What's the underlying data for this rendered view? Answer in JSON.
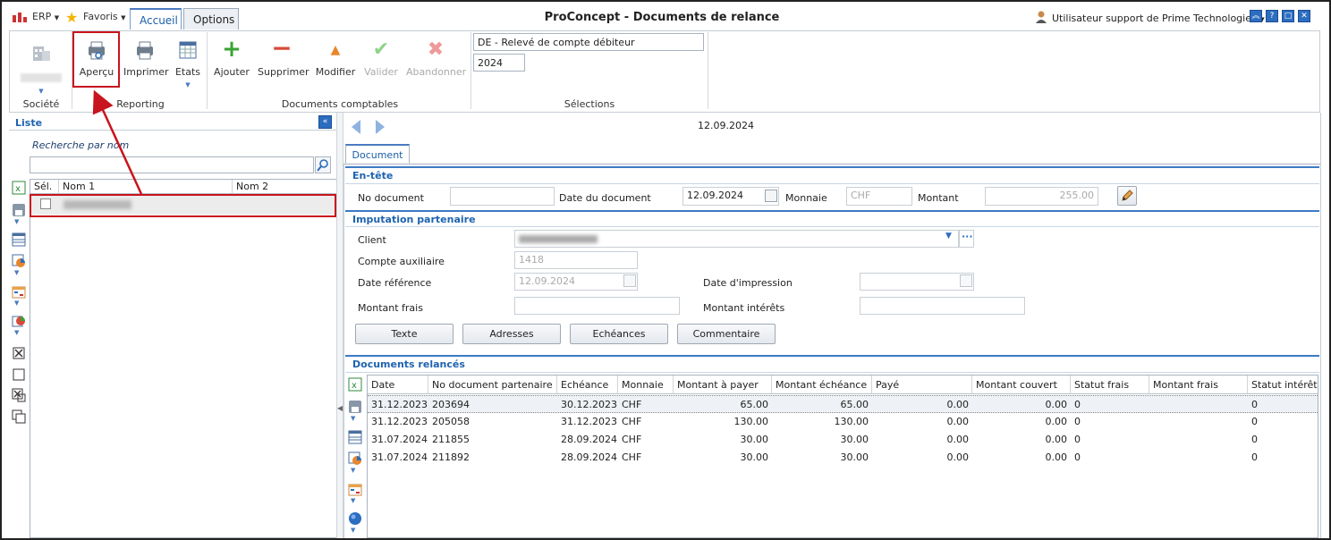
{
  "titlebar": {
    "erp_menu": "ERP",
    "favoris_menu": "Favoris",
    "tabs": [
      "Accueil",
      "Options"
    ],
    "app_title": "ProConcept - Documents de relance",
    "user": "Utilisateur support de Prime Technologies"
  },
  "ribbon": {
    "groups": {
      "societe": "Société",
      "reporting": "Reporting",
      "docs": "Documents comptables",
      "selections": "Sélections"
    },
    "buttons": {
      "apercu": "Aperçu",
      "imprimer": "Imprimer",
      "etats": "Etats",
      "ajouter": "Ajouter",
      "supprimer": "Supprimer",
      "modifier": "Modifier",
      "valider": "Valider",
      "abandonner": "Abandonner"
    },
    "selection_value": "DE - Relevé de compte débiteur",
    "year_value": "2024"
  },
  "liste": {
    "title": "Liste",
    "search_label": "Recherche par nom",
    "columns": [
      "Sél.",
      "Nom 1",
      "Nom 2"
    ]
  },
  "detail": {
    "current_date": "12.09.2024",
    "tab": "Document",
    "entete": {
      "title": "En-tête",
      "no_document_label": "No document",
      "no_document": "",
      "date_doc_label": "Date du document",
      "date_doc": "12.09.2024",
      "monnaie_label": "Monnaie",
      "monnaie": "CHF",
      "montant_label": "Montant",
      "montant": "255.00"
    },
    "imputation": {
      "title": "Imputation partenaire",
      "client_label": "Client",
      "compte_aux_label": "Compte auxiliaire",
      "compte_aux": "1418",
      "date_ref_label": "Date référence",
      "date_ref": "12.09.2024",
      "date_impr_label": "Date d'impression",
      "montant_frais_label": "Montant frais",
      "montant_interets_label": "Montant intérêts"
    },
    "actions": [
      "Texte",
      "Adresses",
      "Echéances",
      "Commentaire"
    ],
    "relances": {
      "title": "Documents relancés",
      "columns": [
        "Date",
        "No document partenaire",
        "Echéance",
        "Monnaie",
        "Montant à payer",
        "Montant échéance",
        "Payé",
        "Montant couvert",
        "Statut frais",
        "Montant frais",
        "Statut intérêts m"
      ],
      "rows": [
        [
          "31.12.2023",
          "203694",
          "30.12.2023",
          "CHF",
          "65.00",
          "65.00",
          "0.00",
          "0.00",
          "0",
          "",
          "0"
        ],
        [
          "31.12.2023",
          "205058",
          "31.12.2023",
          "CHF",
          "130.00",
          "130.00",
          "0.00",
          "0.00",
          "0",
          "",
          "0"
        ],
        [
          "31.07.2024",
          "211855",
          "28.09.2024",
          "CHF",
          "30.00",
          "30.00",
          "0.00",
          "0.00",
          "0",
          "",
          "0"
        ],
        [
          "31.07.2024",
          "211892",
          "28.09.2024",
          "CHF",
          "30.00",
          "30.00",
          "0.00",
          "0.00",
          "0",
          "",
          "0"
        ]
      ]
    }
  },
  "colors": {
    "accent": "#1e63b0",
    "annotation_red": "#c8141e"
  }
}
